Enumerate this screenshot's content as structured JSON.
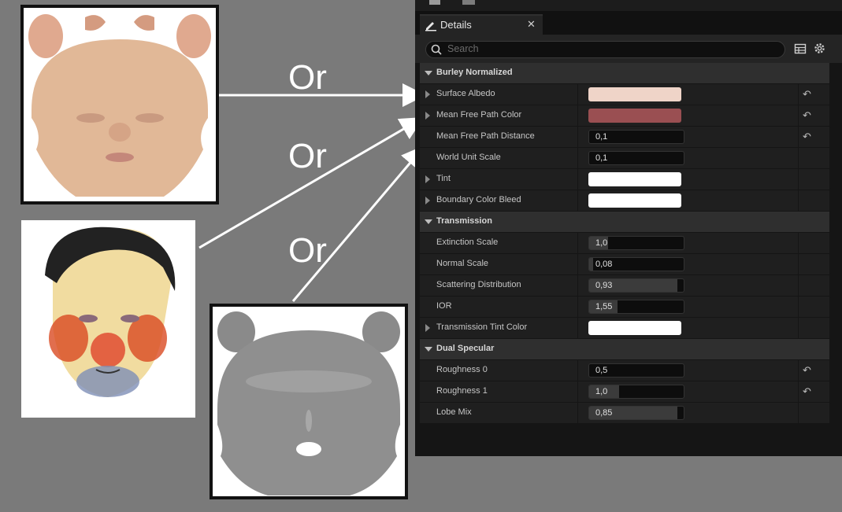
{
  "overlay": {
    "or_labels": [
      "Or",
      "Or",
      "Or"
    ]
  },
  "panel": {
    "tab_title": "Details",
    "search_placeholder": "Search",
    "sections": [
      {
        "title": "Burley Normalized",
        "rows": [
          {
            "label": "Surface Albedo",
            "kind": "color",
            "color": "#efd4c8",
            "expandable": true,
            "reset": true
          },
          {
            "label": "Mean Free Path Color",
            "kind": "color",
            "color": "#9a4f52",
            "expandable": true,
            "reset": true
          },
          {
            "label": "Mean Free Path Distance",
            "kind": "number",
            "value": "0,1",
            "fill": 0,
            "reset": true
          },
          {
            "label": "World Unit Scale",
            "kind": "number",
            "value": "0,1",
            "fill": 0
          },
          {
            "label": "Tint",
            "kind": "color",
            "color": "#ffffff",
            "expandable": true
          },
          {
            "label": "Boundary Color Bleed",
            "kind": "color",
            "color": "#ffffff",
            "expandable": true
          }
        ]
      },
      {
        "title": "Transmission",
        "rows": [
          {
            "label": "Extinction Scale",
            "kind": "number",
            "value": "1,0",
            "fill": 0.2
          },
          {
            "label": "Normal Scale",
            "kind": "number",
            "value": "0,08",
            "fill": 0.04
          },
          {
            "label": "Scattering Distribution",
            "kind": "number",
            "value": "0,93",
            "fill": 0.93
          },
          {
            "label": "IOR",
            "kind": "number",
            "value": "1,55",
            "fill": 0.3
          },
          {
            "label": "Transmission Tint Color",
            "kind": "color",
            "color": "#ffffff",
            "expandable": true
          }
        ]
      },
      {
        "title": "Dual Specular",
        "rows": [
          {
            "label": "Roughness 0",
            "kind": "number",
            "value": "0,5",
            "fill": 0,
            "reset": true
          },
          {
            "label": "Roughness 1",
            "kind": "number",
            "value": "1,0",
            "fill": 0.32,
            "reset": true
          },
          {
            "label": "Lobe Mix",
            "kind": "number",
            "value": "0,85",
            "fill": 0.93
          }
        ]
      }
    ]
  }
}
